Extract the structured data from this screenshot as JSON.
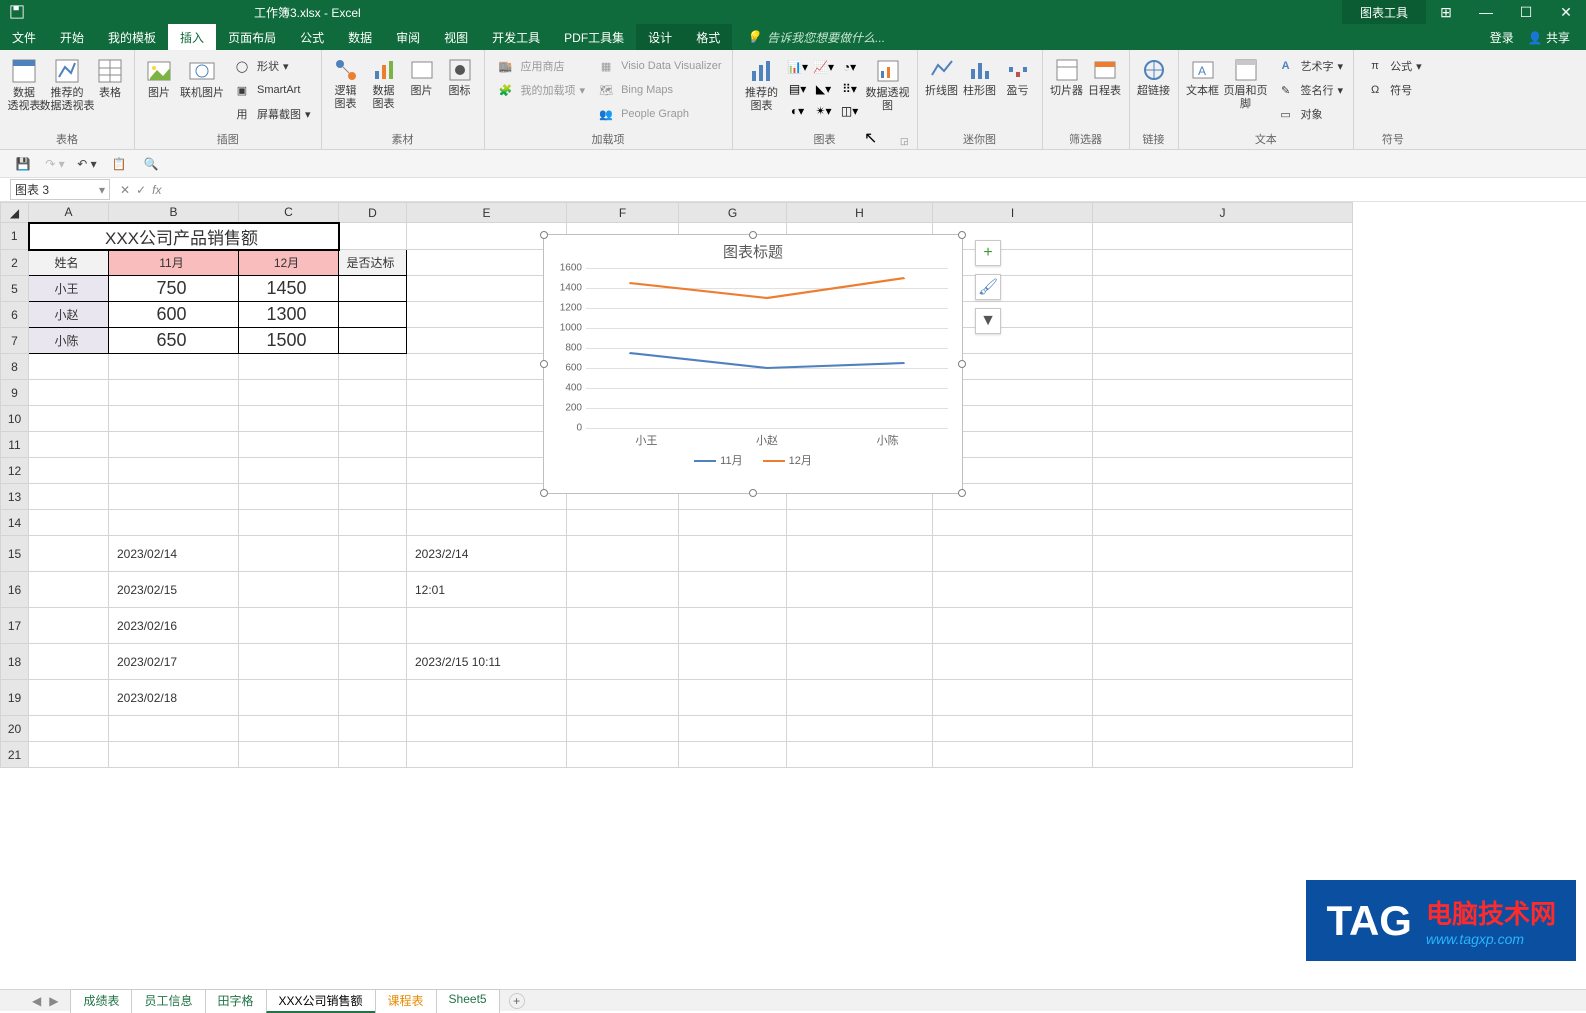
{
  "titlebar": {
    "title": "工作簿3.xlsx - Excel",
    "tools_tab": "图表工具"
  },
  "winbtns": {
    "menu": "⊞",
    "min": "—",
    "max": "☐",
    "close": "✕"
  },
  "tabs": [
    "文件",
    "开始",
    "我的模板",
    "插入",
    "页面布局",
    "公式",
    "数据",
    "审阅",
    "视图",
    "开发工具",
    "PDF工具集"
  ],
  "tabs_active": 3,
  "chart_tabs": [
    "设计",
    "格式"
  ],
  "tell_me": "告诉我您想要做什么...",
  "account": {
    "login": "登录",
    "share": "共享"
  },
  "ribbon": {
    "g1": {
      "label": "表格",
      "pivot": "数据\n透视表",
      "recpivot": "推荐的\n数据透视表",
      "table": "表格"
    },
    "g2": {
      "label": "插图",
      "pic": "图片",
      "online": "联机图片",
      "shapes": "形状",
      "smartart": "SmartArt",
      "screenshot": "屏幕截图"
    },
    "g3": {
      "label": "素材",
      "logic": "逻辑\n图表",
      "data": "数据\n图表",
      "image": "图片",
      "icon": "图标"
    },
    "g4": {
      "label": "加载项",
      "store": "应用商店",
      "myadd": "我的加载项",
      "visio": "Visio Data Visualizer",
      "bing": "Bing Maps",
      "people": "People Graph"
    },
    "g5": {
      "label": "图表",
      "rec": "推荐的\n图表",
      "pivch": "数据透视图"
    },
    "g6": {
      "label": "迷你图",
      "line": "折线图",
      "col": "柱形图",
      "winloss": "盈亏"
    },
    "g7": {
      "label": "筛选器",
      "slicer": "切片器",
      "timeline": "日程表"
    },
    "g8": {
      "label": "链接",
      "link": "超链接"
    },
    "g9": {
      "label": "文本",
      "textbox": "文本框",
      "hf": "页眉和页脚",
      "wordart": "艺术字",
      "sig": "签名行",
      "obj": "对象"
    },
    "g10": {
      "label": "符号",
      "eq": "公式",
      "sym": "符号"
    }
  },
  "namebox": "图表 3",
  "fx": "fx",
  "columns": [
    "A",
    "B",
    "C",
    "D",
    "E",
    "F",
    "G",
    "H",
    "I",
    "J"
  ],
  "rows_visible": [
    1,
    2,
    5,
    6,
    7,
    8,
    9,
    10,
    11,
    12,
    13,
    14,
    15,
    16,
    17,
    18,
    19,
    20,
    21
  ],
  "table": {
    "title": "XXX公司产品销售额",
    "headers": {
      "name": "姓名",
      "nov": "11月",
      "dec": "12月",
      "reach": "是否达标"
    },
    "rows": [
      {
        "name": "小王",
        "nov": 750,
        "dec": 1450
      },
      {
        "name": "小赵",
        "nov": 600,
        "dec": 1300
      },
      {
        "name": "小陈",
        "nov": 650,
        "dec": 1500
      }
    ]
  },
  "dates": {
    "b15": "2023/02/14",
    "b16": "2023/02/15",
    "b17": "2023/02/16",
    "b18": "2023/02/17",
    "b19": "2023/02/18",
    "e15": "2023/2/14",
    "e16": "12:01",
    "e18": "2023/2/15 10:11"
  },
  "chart_data": {
    "type": "line",
    "title": "图表标题",
    "categories": [
      "小王",
      "小赵",
      "小陈"
    ],
    "series": [
      {
        "name": "11月",
        "values": [
          750,
          600,
          650
        ],
        "color": "#4f81bd"
      },
      {
        "name": "12月",
        "values": [
          1450,
          1300,
          1500
        ],
        "color": "#ed7d31"
      }
    ],
    "ylim": [
      0,
      1600
    ],
    "ystep": 200,
    "xlabel": "",
    "ylabel": ""
  },
  "side_buttons": [
    "+",
    "brush",
    "funnel"
  ],
  "sheets": [
    "成绩表",
    "员工信息",
    "田字格",
    "XXX公司销售额",
    "课程表",
    "Sheet5"
  ],
  "sheets_active": 3,
  "tag": {
    "logo": "TAG",
    "line1": "电脑技术网",
    "url": "www.tagxp.com"
  }
}
